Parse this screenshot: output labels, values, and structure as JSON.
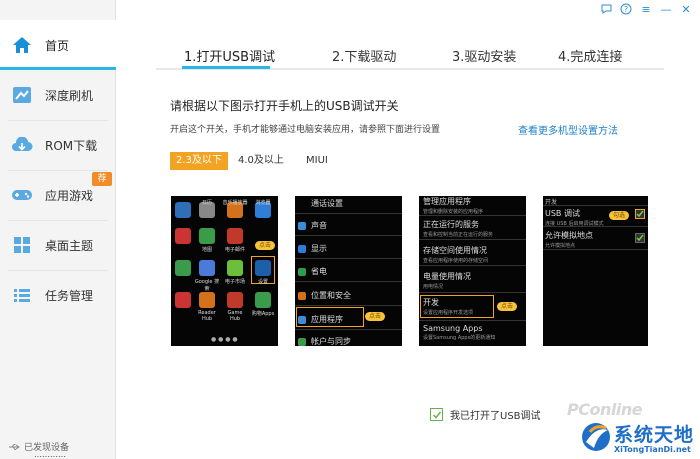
{
  "window_controls": {
    "chat": "chat-bubble-icon",
    "help": "?",
    "menu": "≡",
    "minimize": "—",
    "close": "✕"
  },
  "sidebar": {
    "items": [
      {
        "label": "首页",
        "icon": "home-icon",
        "active": true
      },
      {
        "label": "深度刷机",
        "icon": "flash-icon"
      },
      {
        "label": "ROM下载",
        "icon": "cloud-download-icon"
      },
      {
        "label": "应用游戏",
        "icon": "gamepad-icon",
        "badge": "荐"
      },
      {
        "label": "桌面主题",
        "icon": "grid-icon"
      },
      {
        "label": "任务管理",
        "icon": "list-icon"
      }
    ],
    "status": "已发现设备"
  },
  "steps": [
    "1.打开USB调试",
    "2.下载驱动",
    "3.驱动安装",
    "4.完成连接"
  ],
  "main": {
    "title": "请根据以下图示打开手机上的USB调试开关",
    "desc": "开启这个开关，手机才能够通过电脑安装应用，请参照下面进行设置",
    "more_link": "查看更多机型设置方法"
  },
  "version_tabs": [
    "2.3及以下",
    "4.0及以上",
    "MIUI"
  ],
  "phone1": {
    "apps": [
      "日历",
      "音乐播放器",
      "浏览器",
      "地图",
      "电子邮件",
      "Google 搜索",
      "电子市场",
      "设置",
      "Reader Hub",
      "Game Hub",
      "购物Apps"
    ],
    "tip": "点击"
  },
  "phone2": {
    "items": [
      "通话设置",
      "声音",
      "显示",
      "省电",
      "位置和安全",
      "应用程序",
      "帐户与同步"
    ],
    "tip": "点击"
  },
  "phone3": {
    "items": [
      {
        "title": "管理应用程序",
        "sub": "管理和删除安装的应用程序"
      },
      {
        "title": "正在运行的服务",
        "sub": "查看和控制当前正在运行的服务"
      },
      {
        "title": "存储空间使用情况",
        "sub": "查看应用程序使用的存储空间"
      },
      {
        "title": "电量使用情况",
        "sub": "用电情况"
      },
      {
        "title": "开发",
        "sub": "设置应用程序开发选项"
      },
      {
        "title": "Samsung Apps",
        "sub": "设置Samsung Apps的更新通知"
      }
    ],
    "tip": "点击"
  },
  "phone4": {
    "header": "开发",
    "items": [
      {
        "title": "USB 调试",
        "sub": "连接 USB 后启用调试模式"
      },
      {
        "title": "允许模拟地点",
        "sub": "允许模拟地点"
      }
    ],
    "tip": "勾选"
  },
  "confirm_label": "我已打开了USB调试",
  "watermark": {
    "pconline": "PConline",
    "brand": "系统天地",
    "url": "XiTongTianDi.net"
  },
  "bottom_text": "…………"
}
